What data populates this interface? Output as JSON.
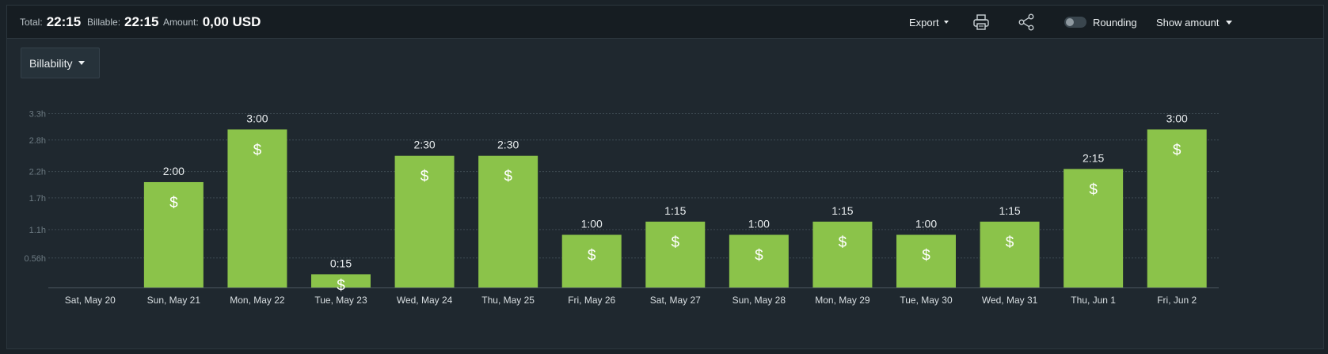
{
  "header": {
    "total_label": "Total:",
    "total_value": "22:15",
    "billable_label": "Billable:",
    "billable_value": "22:15",
    "amount_label": "Amount:",
    "amount_value": "0,00 USD",
    "export_label": "Export",
    "rounding_label": "Rounding",
    "rounding_enabled": false,
    "show_amount_label": "Show amount"
  },
  "filter": {
    "billability_label": "Billability"
  },
  "icons": {
    "print": "printer-icon",
    "share": "share-icon"
  },
  "colors": {
    "bar": "#8bc34a",
    "background": "#1f282f",
    "topbar": "#161d22"
  },
  "chart_data": {
    "type": "bar",
    "categories": [
      "Sat, May 20",
      "Sun, May 21",
      "Mon, May 22",
      "Tue, May 23",
      "Wed, May 24",
      "Thu, May 25",
      "Fri, May 26",
      "Sat, May 27",
      "Sun, May 28",
      "Mon, May 29",
      "Tue, May 30",
      "Wed, May 31",
      "Thu, Jun 1",
      "Fri, Jun 2"
    ],
    "values": [
      0,
      2.0,
      3.0,
      0.25,
      2.5,
      2.5,
      1.0,
      1.25,
      1.0,
      1.25,
      1.0,
      1.25,
      2.25,
      3.0
    ],
    "value_labels": [
      "",
      "2:00",
      "3:00",
      "0:15",
      "2:30",
      "2:30",
      "1:00",
      "1:15",
      "1:00",
      "1:15",
      "1:00",
      "1:15",
      "2:15",
      "3:00"
    ],
    "billable_marker": "$",
    "yticks": [
      {
        "value": 0.56,
        "label": "0.56h"
      },
      {
        "value": 1.1,
        "label": "1.1h"
      },
      {
        "value": 1.7,
        "label": "1.7h"
      },
      {
        "value": 2.2,
        "label": "2.2h"
      },
      {
        "value": 2.8,
        "label": "2.8h"
      },
      {
        "value": 3.3,
        "label": "3.3h"
      }
    ],
    "ylim": [
      0,
      3.33
    ],
    "grid": true,
    "title": "",
    "xlabel": "",
    "ylabel": ""
  }
}
